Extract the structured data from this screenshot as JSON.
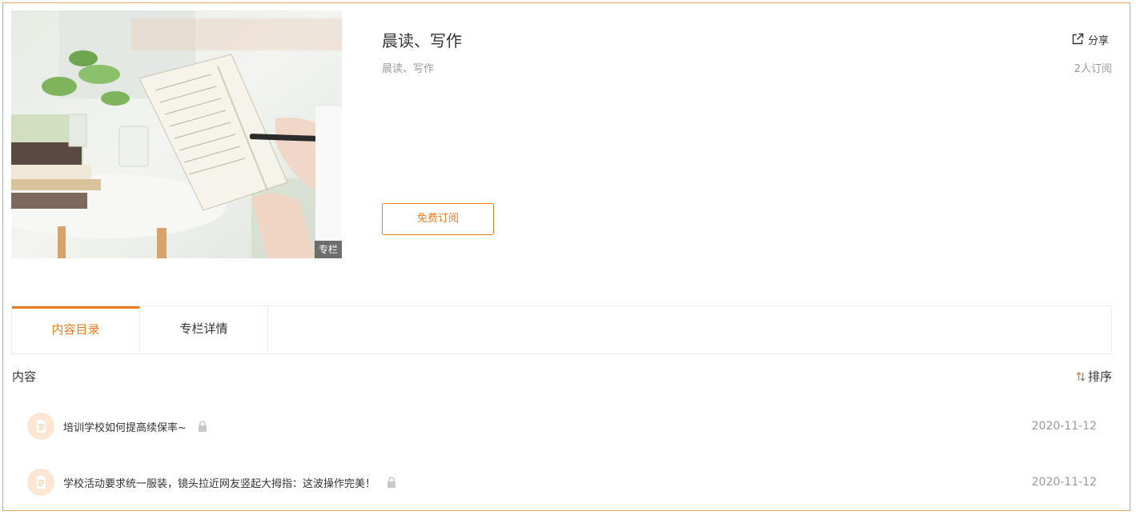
{
  "column": {
    "title": "晨读、写作",
    "subtitle": "晨读、写作",
    "subscribers": "2人订阅",
    "share_label": "分享",
    "cover_badge": "专栏",
    "subscribe_label": "免费订阅"
  },
  "tabs": [
    {
      "label": "内容目录",
      "active": true
    },
    {
      "label": "专栏详情",
      "active": false
    }
  ],
  "content": {
    "section_label": "内容",
    "sort_label": "排序",
    "items": [
      {
        "title": "培训学校如何提高续保率~",
        "date": "2020-11-12",
        "locked": true,
        "icon": "document-icon"
      },
      {
        "title": "学校活动要求统一服装，镜头拉近网友竖起大拇指：这波操作完美！",
        "date": "2020-11-12",
        "locked": true,
        "icon": "document-icon"
      }
    ]
  },
  "colors": {
    "accent": "#e87c1e",
    "border": "#e3a35a",
    "muted_text": "#999999",
    "icon_bg": "#fde7d4"
  }
}
